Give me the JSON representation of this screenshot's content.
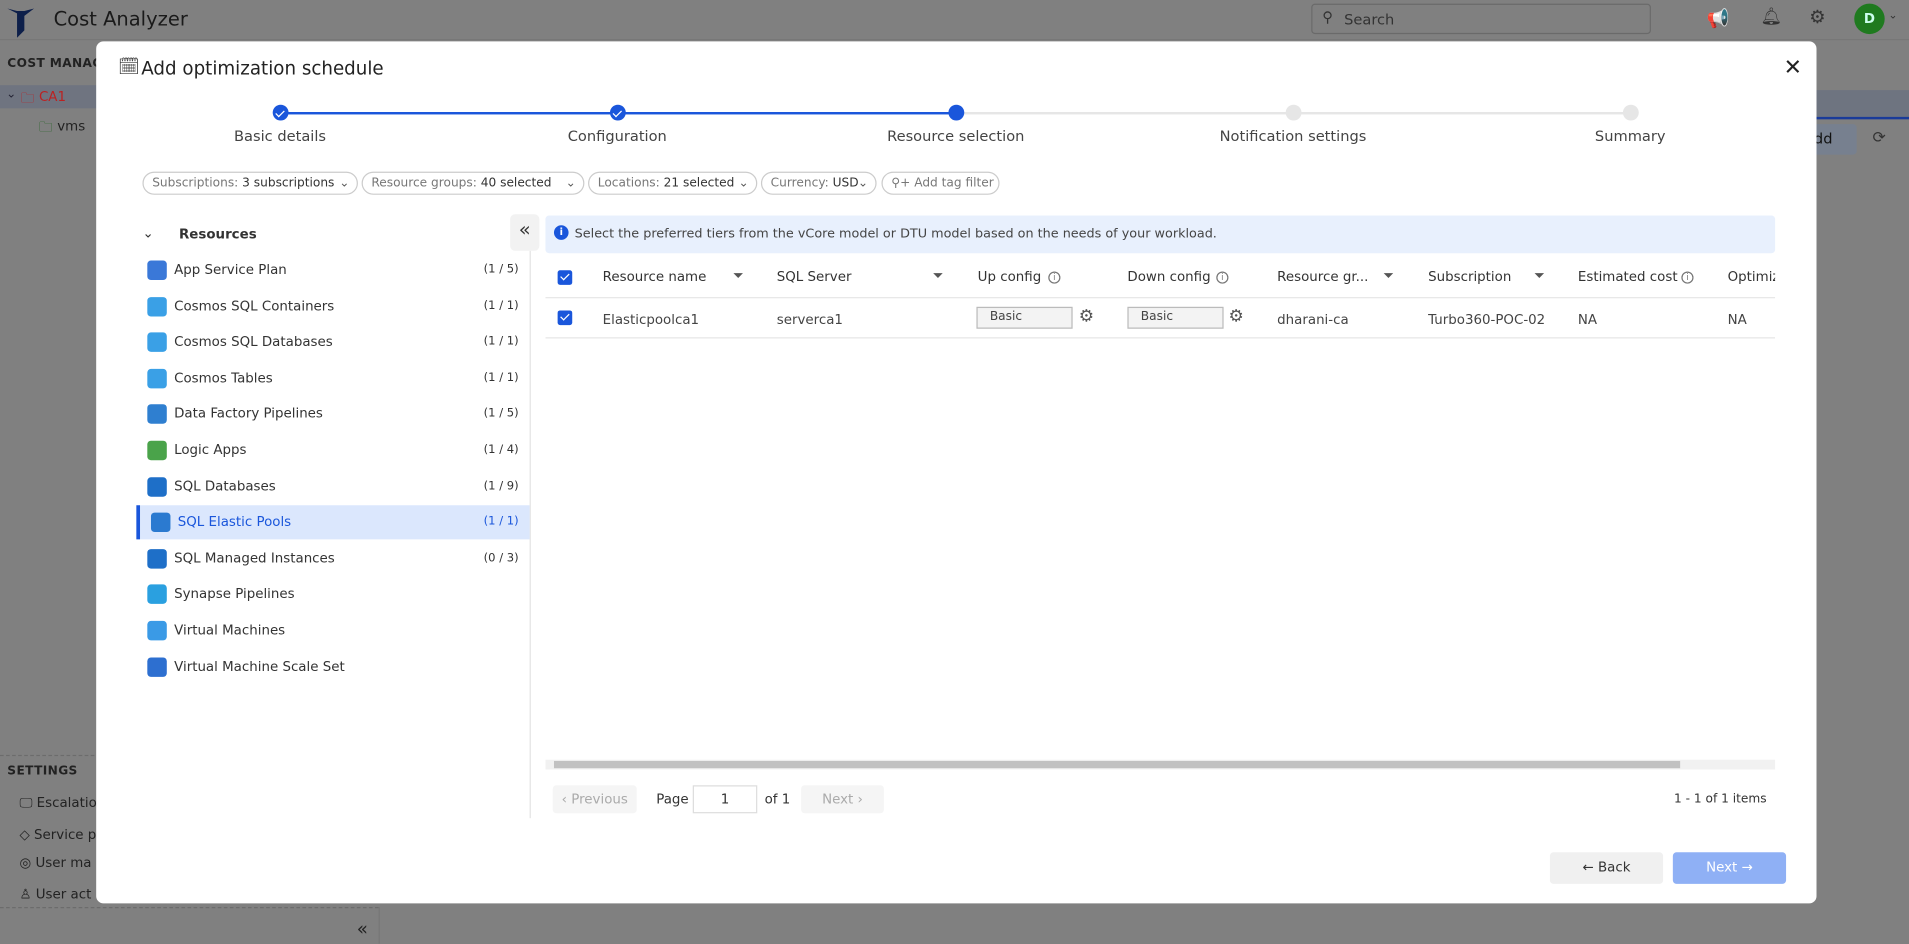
{
  "app": {
    "title": "Cost Analyzer",
    "search_placeholder": "Search",
    "avatar_initial": "D"
  },
  "sidebar": {
    "section_cost": "COST MANAGE",
    "tree": [
      {
        "label": "CA1",
        "color": "#c62828"
      },
      {
        "label": "vms",
        "color": "#2e7d32"
      }
    ],
    "section_settings": "SETTINGS",
    "settings_items": [
      "Escalatio",
      "Service p",
      "User ma",
      "User act"
    ]
  },
  "background": {
    "add_button": "dd"
  },
  "modal": {
    "title": "Add optimization schedule",
    "steps": [
      {
        "label": "Basic details",
        "state": "done"
      },
      {
        "label": "Configuration",
        "state": "done"
      },
      {
        "label": "Resource selection",
        "state": "current"
      },
      {
        "label": "Notification settings",
        "state": "todo"
      },
      {
        "label": "Summary",
        "state": "todo"
      }
    ],
    "filters": [
      {
        "key": "Subscriptions:",
        "value": "3 subscriptions"
      },
      {
        "key": "Resource groups:",
        "value": "40 selected"
      },
      {
        "key": "Locations:",
        "value": "21 selected"
      },
      {
        "key": "Currency:",
        "value": "USD"
      }
    ],
    "add_tag_filter": "Add tag filter",
    "resources_header": "Resources",
    "resources": [
      {
        "name": "App Service Plan",
        "count": "(1 / 5)",
        "icon": "app-service-plan-icon",
        "color": "#3a78d8"
      },
      {
        "name": "Cosmos SQL Containers",
        "count": "(1 / 1)",
        "icon": "cosmos-db-icon",
        "color": "#3aa0e6"
      },
      {
        "name": "Cosmos SQL Databases",
        "count": "(1 / 1)",
        "icon": "cosmos-db-icon",
        "color": "#3aa0e6"
      },
      {
        "name": "Cosmos Tables",
        "count": "(1 / 1)",
        "icon": "cosmos-db-icon",
        "color": "#3aa0e6"
      },
      {
        "name": "Data Factory Pipelines",
        "count": "(1 / 5)",
        "icon": "data-factory-icon",
        "color": "#2f7fd0"
      },
      {
        "name": "Logic Apps",
        "count": "(1 / 4)",
        "icon": "logic-apps-icon",
        "color": "#4aa34a"
      },
      {
        "name": "SQL Databases",
        "count": "(1 / 9)",
        "icon": "sql-database-icon",
        "color": "#1e6fc8"
      },
      {
        "name": "SQL Elastic Pools",
        "count": "(1 / 1)",
        "icon": "sql-elastic-pool-icon",
        "color": "#2b7ad0",
        "selected": true
      },
      {
        "name": "SQL Managed Instances",
        "count": "(0 / 3)",
        "icon": "sql-managed-instance-icon",
        "color": "#1e6fc8"
      },
      {
        "name": "Synapse Pipelines",
        "count": "",
        "icon": "synapse-icon",
        "color": "#2aa0e0"
      },
      {
        "name": "Virtual Machines",
        "count": "",
        "icon": "virtual-machine-icon",
        "color": "#3a9ae6"
      },
      {
        "name": "Virtual Machine Scale Set",
        "count": "",
        "icon": "vm-scale-set-icon",
        "color": "#2d6fd0"
      }
    ],
    "info_banner": "Select the preferred tiers from the vCore model or DTU model based on the needs of your workload.",
    "table": {
      "headers": [
        "Resource name",
        "SQL Server",
        "Up config",
        "Down config",
        "Resource gr...",
        "Subscription",
        "Estimated cost",
        "Optimiz"
      ],
      "rows": [
        {
          "checked": true,
          "resource_name": "Elasticpoolca1",
          "sql_server": "serverca1",
          "up_config": "Basic",
          "down_config": "Basic",
          "resource_group": "dharani-ca",
          "subscription": "Turbo360-POC-02",
          "estimated_cost": "NA",
          "optimization": "NA"
        }
      ]
    },
    "pagination": {
      "previous": "Previous",
      "page_label": "Page",
      "page": "1",
      "of": "of 1",
      "next": "Next",
      "summary": "1 - 1 of 1 items"
    },
    "back_label": "Back",
    "next_label": "Next",
    "accent": "#1a56db"
  }
}
